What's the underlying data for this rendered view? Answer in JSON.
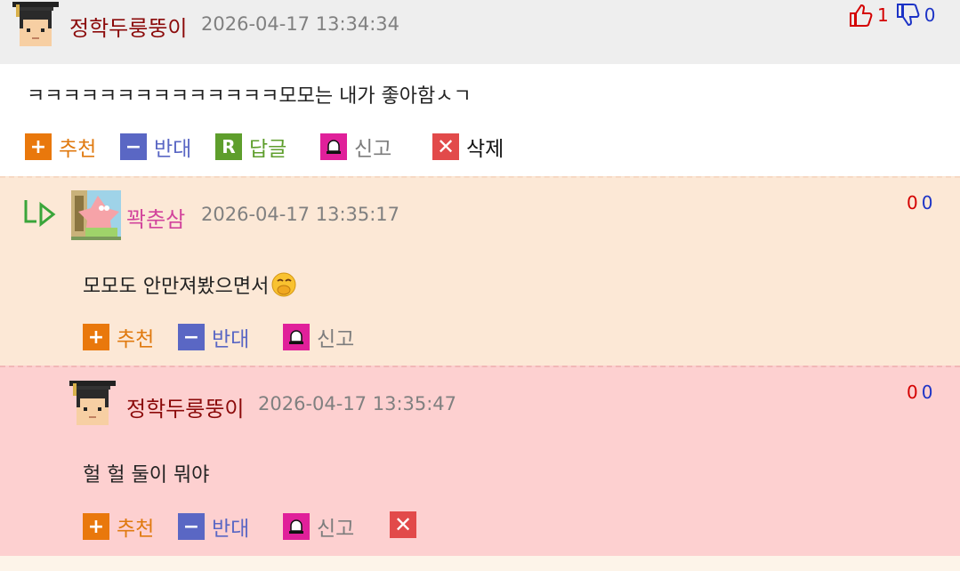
{
  "main_comment": {
    "nickname": "정학두룽뚱이",
    "date": "2026-04-17 13:34:34",
    "text": "ㅋㅋㅋㅋㅋㅋㅋㅋㅋㅋㅋㅋㅋㅋ모모는 내가 좋아함ㅅㄱ",
    "up_count": "1",
    "down_count": "0",
    "actions": {
      "recommend": "추천",
      "oppose": "반대",
      "reply": "답글",
      "report": "신고",
      "delete": "삭제"
    }
  },
  "reply1": {
    "nickname": "꽉춘삼",
    "date": "2026-04-17 13:35:17",
    "text": "모모도 안만져봤으면서",
    "up_count": "0",
    "down_count": "0",
    "actions": {
      "recommend": "추천",
      "oppose": "반대",
      "report": "신고"
    }
  },
  "reply2": {
    "nickname": "정학두룽뚱이",
    "date": "2026-04-17 13:35:47",
    "text": "헐 헐 둘이 뭐야",
    "up_count": "0",
    "down_count": "0",
    "actions": {
      "recommend": "추천",
      "oppose": "반대",
      "report": "신고"
    }
  },
  "icons": {
    "recommend": "plus-icon",
    "oppose": "minus-icon",
    "reply": "reply-r-icon",
    "report": "siren-icon",
    "delete": "close-x-icon",
    "thumb_up": "thumbs-up-icon",
    "thumb_down": "thumbs-down-icon",
    "reply_arrow": "reply-arrow-icon"
  },
  "colors": {
    "nick_main": "#8b0a0a",
    "nick_pink": "#d2449c",
    "recommend": "#e9780c",
    "oppose": "#5a67c4",
    "reply": "#5e9e2c",
    "report": "#e0209a",
    "delete": "#e24a4a"
  }
}
